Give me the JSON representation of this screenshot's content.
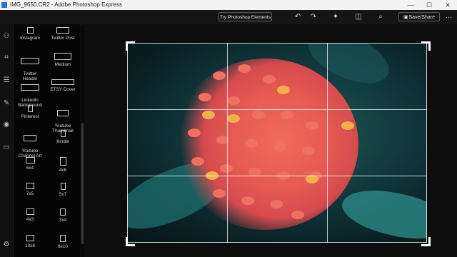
{
  "window": {
    "title": "IMG_9650.CR2 - Adobe Photoshop Express",
    "minimize": "—",
    "maximize": "☐",
    "close": "✕"
  },
  "toolbar": {
    "try_button": "Try Photoshop Elements",
    "save_button": "Save/Share",
    "more": "···"
  },
  "presets": [
    {
      "label": "Instagram"
    },
    {
      "label": "Twitter Post"
    },
    {
      "label": "Twitter\nHeader"
    },
    {
      "label": "Medium"
    },
    {
      "label": "Linkedin\nBackground"
    },
    {
      "label": "ETSY Cover"
    },
    {
      "label": "Pinterest"
    },
    {
      "label": "Youtube\nThumbnail"
    },
    {
      "label": "Youtube\nChannel Art"
    },
    {
      "label": "Kindle"
    },
    {
      "label": "6x4"
    },
    {
      "label": "4x6"
    },
    {
      "label": "7x5"
    },
    {
      "label": "5x7"
    },
    {
      "label": "4x3"
    },
    {
      "label": "3x4"
    },
    {
      "label": "10x8"
    },
    {
      "label": "8x10"
    }
  ]
}
